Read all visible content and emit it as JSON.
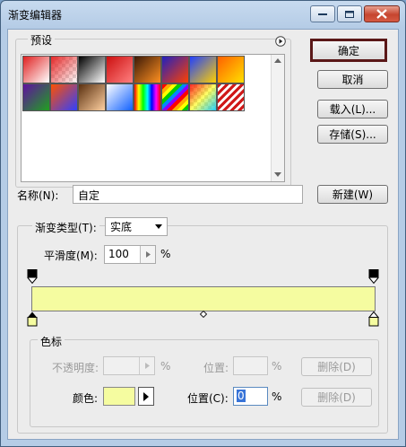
{
  "window": {
    "title": "渐变编辑器"
  },
  "buttons": {
    "ok": "确定",
    "cancel": "取消",
    "load": "载入(L)...",
    "save": "存储(S)...",
    "new": "新建(W)"
  },
  "presets": {
    "label": "预设",
    "swatches": [
      [
        "#e02020",
        "#ffffff"
      ],
      [
        "checker-red",
        ""
      ],
      [
        "#000000",
        "#ffffff"
      ],
      [
        "#cc1010",
        "#ff8080"
      ],
      [
        "#3c1a08",
        "#ff9020"
      ],
      [
        "#2020c0",
        "#ff4000"
      ],
      [
        "#2040ff",
        "#ffd000"
      ],
      [
        "#ff6000",
        "#ffe000"
      ],
      [
        "#6010a0",
        "#20a020"
      ],
      [
        "#ff5000",
        "#3040ff"
      ],
      [
        "#5a3010",
        "#ffd0a0"
      ],
      [
        "#ffffff",
        "#1060ff"
      ],
      [
        "rainbow",
        ""
      ],
      [
        "rainbow-diag",
        ""
      ],
      [
        "checker-rainbow",
        ""
      ],
      [
        "stripe-red",
        ""
      ]
    ]
  },
  "name": {
    "label": "名称(N):",
    "value": "自定"
  },
  "gradient": {
    "type_label": "渐变类型(T):",
    "type_value": "实底",
    "smooth_label": "平滑度(M):",
    "smooth_value": "100",
    "smooth_unit": "%",
    "bar_color": "#f5fca0",
    "midpoint_percent": 50
  },
  "stops": {
    "group_label": "色标",
    "opacity_label": "不透明度:",
    "opacity_unit": "%",
    "position_label": "位置:",
    "position_unit": "%",
    "delete_label": "删除(D)",
    "color_label": "颜色:",
    "color_value": "#f5fca0",
    "color_position_label": "位置(C):",
    "color_position_value": "0",
    "color_position_unit": "%"
  }
}
